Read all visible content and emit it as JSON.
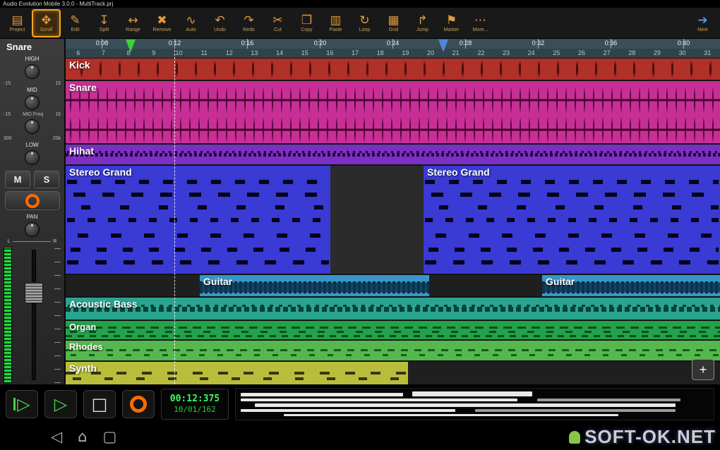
{
  "window": {
    "title": "Audio Evolution Mobile 3.0.0 - MultiTrack.prj"
  },
  "toolbar": {
    "buttons": [
      {
        "name": "toolbar-button-project",
        "label": "Project",
        "icon": "project-icon",
        "glyph": "▤",
        "active": false
      },
      {
        "name": "toolbar-button-scroll",
        "label": "Scroll",
        "icon": "scroll-icon",
        "glyph": "✥",
        "active": true
      },
      {
        "name": "toolbar-button-edit",
        "label": "Edit",
        "icon": "edit-icon",
        "glyph": "✎",
        "active": false
      },
      {
        "name": "toolbar-button-split",
        "label": "Split",
        "icon": "split-icon",
        "glyph": "↧",
        "active": false
      },
      {
        "name": "toolbar-button-range",
        "label": "Range",
        "icon": "range-icon",
        "glyph": "↔",
        "active": false
      },
      {
        "name": "toolbar-button-remove",
        "label": "Remove",
        "icon": "remove-icon",
        "glyph": "✖",
        "active": false
      },
      {
        "name": "toolbar-button-auto",
        "label": "Auto",
        "icon": "auto-icon",
        "glyph": "∿",
        "active": false
      },
      {
        "name": "toolbar-button-undo",
        "label": "Undo",
        "icon": "undo-icon",
        "glyph": "↶",
        "active": false
      },
      {
        "name": "toolbar-button-redo",
        "label": "Redo",
        "icon": "redo-icon",
        "glyph": "↷",
        "active": false
      },
      {
        "name": "toolbar-button-cut",
        "label": "Cut",
        "icon": "cut-icon",
        "glyph": "✂",
        "active": false
      },
      {
        "name": "toolbar-button-copy",
        "label": "Copy",
        "icon": "copy-icon",
        "glyph": "❐",
        "active": false
      },
      {
        "name": "toolbar-button-paste",
        "label": "Paste",
        "icon": "paste-icon",
        "glyph": "▥",
        "active": false
      },
      {
        "name": "toolbar-button-loop",
        "label": "Loop",
        "icon": "loop-icon",
        "glyph": "↻",
        "active": false
      },
      {
        "name": "toolbar-button-grid",
        "label": "Grid",
        "icon": "grid-icon",
        "glyph": "▦",
        "active": false
      },
      {
        "name": "toolbar-button-jump",
        "label": "Jump",
        "icon": "jump-icon",
        "glyph": "↱",
        "active": false
      },
      {
        "name": "toolbar-button-marker",
        "label": "Marker",
        "icon": "marker-icon",
        "glyph": "⚑",
        "active": false
      },
      {
        "name": "toolbar-button-more",
        "label": "More...",
        "icon": "more-icon",
        "glyph": "⋯",
        "active": false
      }
    ],
    "next": {
      "label": "Next",
      "icon": "next-icon",
      "glyph": "➔"
    }
  },
  "channel_strip": {
    "track_name": "Snare",
    "eq": {
      "high_label": "HIGH",
      "mid_label": "MID",
      "mid_freq_label": "MID Freq",
      "low_label": "LOW",
      "gain_min": "-15",
      "gain_max": "15",
      "freq_min": "300",
      "freq_max": "20k"
    },
    "mute_label": "M",
    "solo_label": "S",
    "pan_label": "PAN",
    "pan_left": "L",
    "pan_right": "R"
  },
  "ruler": {
    "times": [
      "0:08",
      "0:12",
      "0:16",
      "0:20",
      "0:24",
      "0:28",
      "0:32",
      "0:36",
      "0:40"
    ],
    "beats": [
      "6",
      "7",
      "8",
      "9",
      "10",
      "11",
      "12",
      "13",
      "14",
      "15",
      "16",
      "17",
      "18",
      "19",
      "20",
      "21",
      "22",
      "23",
      "24",
      "25",
      "26",
      "27",
      "28",
      "29",
      "30",
      "31"
    ]
  },
  "tracks": [
    {
      "name": "Kick",
      "color": "#b0302a"
    },
    {
      "name": "Snare",
      "color": "#c72f96"
    },
    {
      "name": "Hihat",
      "color": "#7c2fc4"
    },
    {
      "name": "Stereo Grand",
      "color": "#3a3ad4"
    },
    {
      "name": "Guitar",
      "color": "#3796c8"
    },
    {
      "name": "Acoustic Bass",
      "color": "#2aa38f"
    },
    {
      "name": "Organ",
      "color": "#23a14b"
    },
    {
      "name": "Rhodes",
      "color": "#55b84f"
    },
    {
      "name": "Synth",
      "color": "#b9bd3c"
    }
  ],
  "track_area": {
    "add_label": "+"
  },
  "transport": {
    "play_glyph": "▷",
    "stop_glyph": "□",
    "time_main": "00:12:375",
    "time_bars": "10/01/162"
  },
  "nav_bar": {
    "back_glyph": "◁",
    "home_glyph": "⌂",
    "recents_glyph": "▢"
  },
  "watermark": {
    "text": "SOFT-OK.NET"
  },
  "colors": {
    "accent_orange": "#f5a623",
    "icon_amber": "#e09a3c",
    "icon_blue": "#4d9fe8",
    "timeline_bg": "#3a4f57",
    "record_orange": "#ff6a00",
    "meter_green": "#26d63f",
    "display_green": "#39ff5e",
    "marker_green": "#3bd13b",
    "marker_blue": "#4f86d6"
  }
}
